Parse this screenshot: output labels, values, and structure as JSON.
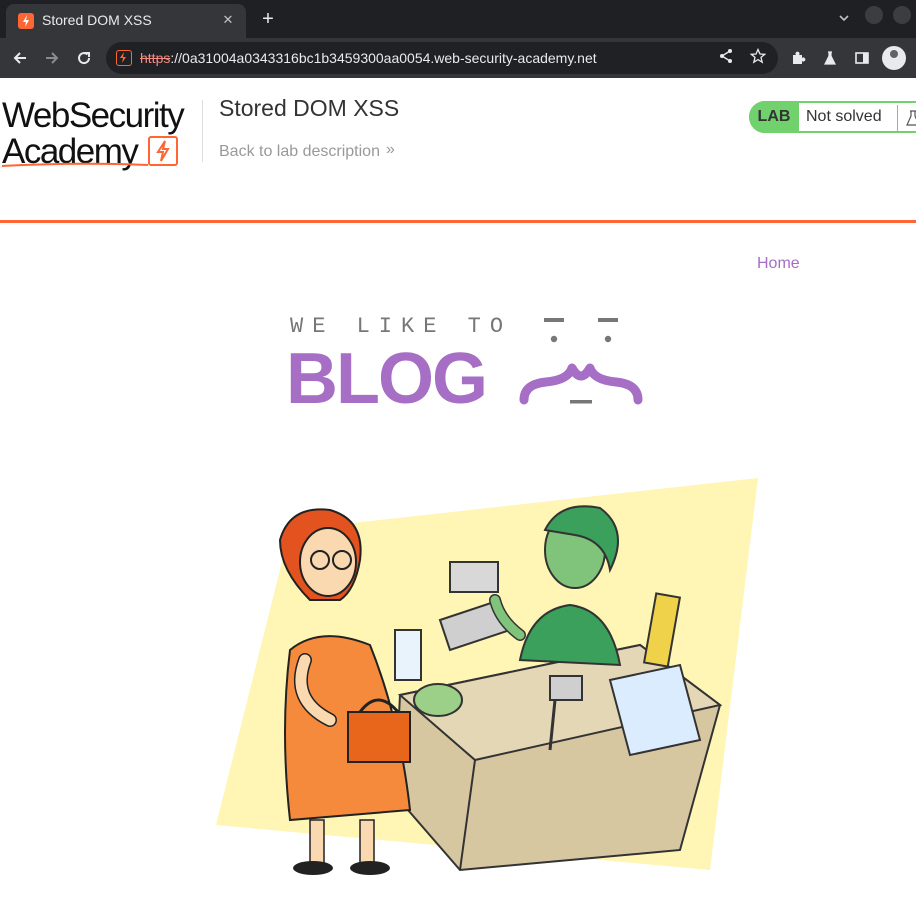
{
  "browser": {
    "tab_title": "Stored DOM XSS",
    "tab_close": "✕",
    "new_tab": "+",
    "url_scheme": "https",
    "url_rest": "://0a31004a0343316bc1b3459300aa0054.web-security-academy.net"
  },
  "header": {
    "logo_line1": "WebSecurity",
    "logo_line2": "Academy",
    "lab_title": "Stored DOM XSS",
    "back_link": "Back to lab description",
    "back_chevron": "»",
    "lab_badge": "LAB",
    "lab_status": "Not solved"
  },
  "nav": {
    "home": "Home"
  },
  "blog": {
    "tagline": "WE LIKE TO",
    "word": "BLOG"
  },
  "colors": {
    "accent_orange": "#ff6633",
    "blog_purple": "#a66ec4",
    "lab_green": "#70d16d"
  }
}
